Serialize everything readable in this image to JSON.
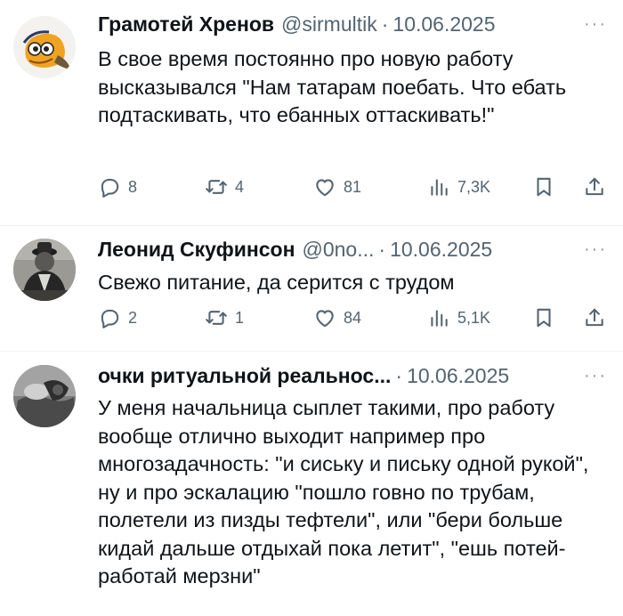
{
  "tweets": [
    {
      "name": "Грамотей Хренов",
      "handle": "@sirmultik",
      "separator": "·",
      "date": "10.06.2025",
      "more": "···",
      "text": "В свое время постоянно про новую работу высказывался \"Нам татарам поебать. Что ебать подтаскивать, что ебанных оттаскивать!\"",
      "replies": "8",
      "retweets": "4",
      "likes": "81",
      "views": "7,3K"
    },
    {
      "name": "Леонид Скуфинсон",
      "handle": "@0no...",
      "separator": "·",
      "date": "10.06.2025",
      "more": "···",
      "text": "Свежо питание, да серится с трудом",
      "replies": "2",
      "retweets": "1",
      "likes": "84",
      "views": "5,1K"
    },
    {
      "name": "очки ритуальной реальнос...",
      "separator": "·",
      "date": "10.06.2025",
      "more": "···",
      "text": "У меня начальница сыплет такими, про работу вообще отлично выходит например про многозадачность: \"и сиську и письку одной рукой\", ну и про эскалацию \"пошло говно по трубам, полетели из пизды тефтели\", или \"бери больше кидай дальше отдыхай пока летит\", \"ешь потей- работай мерзни\""
    }
  ],
  "icons": {
    "reply": "reply-icon",
    "retweet": "retweet-icon",
    "like": "heart-icon",
    "views": "views-icon",
    "bookmark": "bookmark-icon",
    "share": "share-icon"
  },
  "colors": {
    "text": "#0f1419",
    "secondary": "#536471",
    "separator": "#eff3f4"
  }
}
